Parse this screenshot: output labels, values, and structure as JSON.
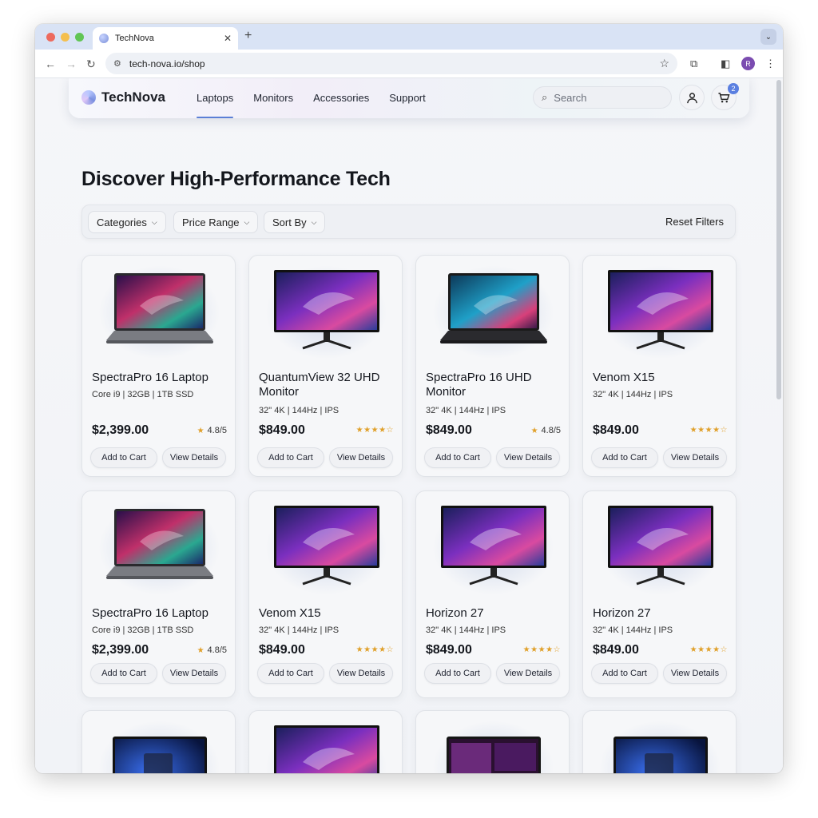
{
  "browser": {
    "tab_title": "TechNova",
    "url": "tech-nova.io/shop",
    "profile_initial": "R"
  },
  "site": {
    "logo": "TechNova",
    "nav": [
      "Laptops",
      "Monitors",
      "Accessories",
      "Support"
    ],
    "active_nav": "Laptops",
    "search_placeholder": "Search",
    "cart_count": "2"
  },
  "page": {
    "heading": "Discover High-Performance Tech"
  },
  "filters": {
    "categories": "Categories",
    "price_range": "Price Range",
    "sort_by": "Sort By",
    "reset": "Reset Filters"
  },
  "buttons": {
    "add": "Add to Cart",
    "details": "View Details"
  },
  "products": [
    {
      "name": "SpectraPro 16 Laptop",
      "spec": "Core i9 | 32GB | 1TB SSD",
      "price": "$2,399.00",
      "rating": "4.8/5",
      "kind": "laptop"
    },
    {
      "name": "QuantumView 32 UHD Monitor",
      "spec": "32\" 4K | 144Hz | IPS",
      "price": "$849.00",
      "rating": "",
      "kind": "monitor"
    },
    {
      "name": "SpectraPro 16 UHD Monitor",
      "spec": "32\" 4K | 144Hz | IPS",
      "price": "$849.00",
      "rating": "4.8/5",
      "kind": "laptop-dark"
    },
    {
      "name": "Venom X15",
      "spec": "32\" 4K | 144Hz | IPS",
      "price": "$849.00",
      "rating": "",
      "kind": "monitor"
    },
    {
      "name": "SpectraPro 16 Laptop",
      "spec": "Core i9 | 32GB | 1TB SSD",
      "price": "$2,399.00",
      "rating": "4.8/5",
      "kind": "laptop"
    },
    {
      "name": "Venom X15",
      "spec": "32\" 4K | 144Hz | IPS",
      "price": "$849.00",
      "rating": "",
      "kind": "monitor"
    },
    {
      "name": "Horizon 27",
      "spec": "32\" 4K | 144Hz | IPS",
      "price": "$849.00",
      "rating": "",
      "kind": "monitor"
    },
    {
      "name": "Horizon 27",
      "spec": "32\" 4K | 144Hz | IPS",
      "price": "$849.00",
      "rating": "",
      "kind": "monitor"
    },
    {
      "name": "",
      "spec": "",
      "price": "",
      "rating": "",
      "kind": "windows"
    },
    {
      "name": "",
      "spec": "",
      "price": "",
      "rating": "",
      "kind": "monitor"
    },
    {
      "name": "",
      "spec": "",
      "price": "",
      "rating": "",
      "kind": "laptop-open"
    },
    {
      "name": "",
      "spec": "",
      "price": "",
      "rating": "",
      "kind": "windows"
    }
  ],
  "colors": {
    "accent": "#5b7fd6",
    "star": "#e0a02a"
  }
}
